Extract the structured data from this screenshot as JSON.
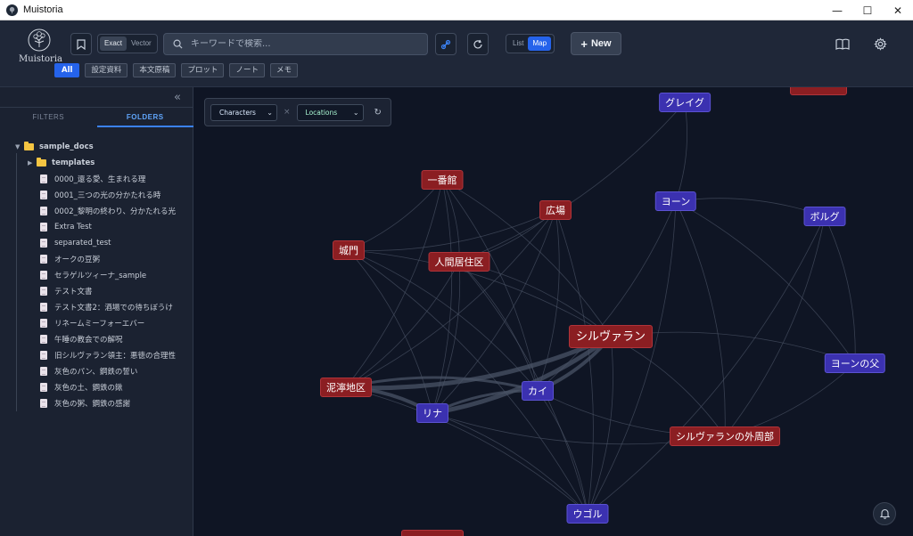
{
  "window": {
    "title": "Muistoria"
  },
  "header": {
    "logo_text": "Muistoria",
    "search_mode": {
      "exact": "Exact",
      "vector": "Vector",
      "selected": "Exact"
    },
    "search": {
      "placeholder": "キーワードで検索..."
    },
    "view_mode": {
      "list": "List",
      "map": "Map",
      "selected": "Map"
    },
    "new_label": "New",
    "filter_chips": [
      {
        "label": "All",
        "active": true
      },
      {
        "label": "設定資料",
        "active": false
      },
      {
        "label": "本文原稿",
        "active": false
      },
      {
        "label": "プロット",
        "active": false
      },
      {
        "label": "ノート",
        "active": false
      },
      {
        "label": "メモ",
        "active": false
      }
    ]
  },
  "sidebar": {
    "tabs": [
      {
        "label": "FILTERS",
        "active": false
      },
      {
        "label": "FOLDERS",
        "active": true
      }
    ],
    "tree": {
      "root": "sample_docs",
      "folders": [
        "templates"
      ],
      "files": [
        "0000_還る愛、生まれる理",
        "0001_三つの光の分かたれる時",
        "0002_黎明の終わり、分かたれる光",
        "Extra Test",
        "separated_test",
        "オークの豆粥",
        "セラゲルツィーナ_sample",
        "テスト文書",
        "テスト文書2：酒場での待ちぼうけ",
        "リネームミーフォーエバー",
        "午睡の教会での解呪",
        "旧シルヴァラン領主：悪徳の合理性",
        "灰色のパン、鋼鉄の誓い",
        "灰色の土、鋼鉄の鍬",
        "灰色の粥、鋼鉄の感謝"
      ]
    }
  },
  "graph": {
    "filter": {
      "left": "Characters",
      "separator": "×",
      "right": "Locations"
    },
    "colors": {
      "character": "#3b31b0",
      "location": "#8b1e22",
      "edge": "#4a5365"
    },
    "nodes": [
      {
        "id": "gureigu",
        "label": "グレイグ",
        "type": "character"
      },
      {
        "id": "ichibankan",
        "label": "一番館",
        "type": "location"
      },
      {
        "id": "hiroba",
        "label": "広場",
        "type": "location"
      },
      {
        "id": "yon",
        "label": "ヨーン",
        "type": "character"
      },
      {
        "id": "borugu",
        "label": "ボルグ",
        "type": "character"
      },
      {
        "id": "jomon",
        "label": "城門",
        "type": "location"
      },
      {
        "id": "ningen",
        "label": "人間居住区",
        "type": "location"
      },
      {
        "id": "silvaran",
        "label": "シルヴァラン",
        "type": "location"
      },
      {
        "id": "yonnochichi",
        "label": "ヨーンの父",
        "type": "character"
      },
      {
        "id": "deitaku",
        "label": "泥濘地区",
        "type": "location"
      },
      {
        "id": "kai",
        "label": "カイ",
        "type": "character"
      },
      {
        "id": "rina",
        "label": "リナ",
        "type": "character"
      },
      {
        "id": "gaishubu",
        "label": "シルヴァランの外周部",
        "type": "location"
      },
      {
        "id": "ugoru",
        "label": "ウゴル",
        "type": "character"
      }
    ]
  }
}
